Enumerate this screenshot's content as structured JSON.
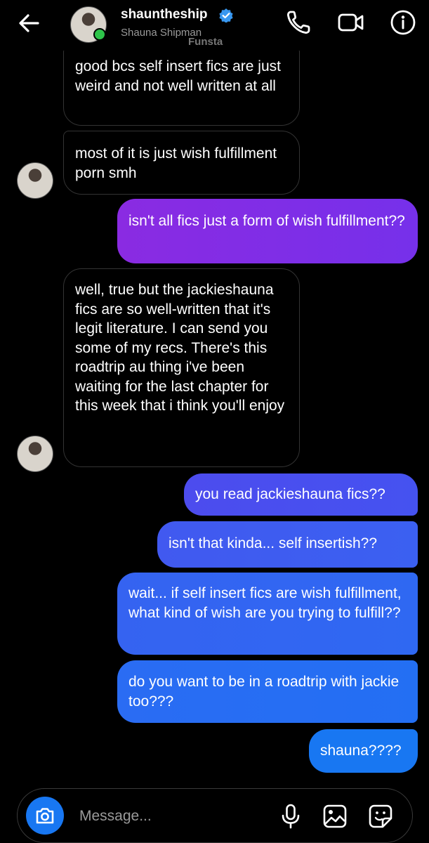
{
  "header": {
    "username": "shauntheship",
    "display_name": "Shauna Shipman",
    "watermark": "Funsta",
    "icons": [
      "back-arrow-icon",
      "verified-badge-icon",
      "phone-call-icon",
      "video-call-icon",
      "info-icon"
    ]
  },
  "messages": [
    {
      "from": "them",
      "text": "good bcs self insert fics are just weird and not well written at all"
    },
    {
      "from": "them",
      "text": "most of it is just wish fulfillment porn smh"
    },
    {
      "from": "me",
      "text": "isn't all fics just a form of wish fulfillment??"
    },
    {
      "from": "them",
      "text": "well, true but the jackieshauna fics are so well-written that it's legit literature. I can send you some of my recs. There's this roadtrip au thing i've been waiting for the last chapter for this week that i think you'll enjoy"
    },
    {
      "from": "me",
      "text": "you read jackieshauna fics??"
    },
    {
      "from": "me",
      "text": "isn't that kinda... self insertish??"
    },
    {
      "from": "me",
      "text": "wait... if self insert fics are wish fulfillment, what kind of wish are you trying to fulfill??"
    },
    {
      "from": "me",
      "text": "do you want to be in a roadtrip with jackie too???"
    },
    {
      "from": "me",
      "text": "shauna????"
    }
  ],
  "composer": {
    "placeholder": "Message...",
    "icons": [
      "camera-icon",
      "microphone-icon",
      "gallery-icon",
      "sticker-icon"
    ]
  },
  "colors": {
    "background": "#000000",
    "outgoing_gradient": [
      "#8a2be2",
      "#6a3cf0",
      "#3d5cf2",
      "#1877f2"
    ],
    "incoming_border": "#333333",
    "accent": "#1877f2"
  }
}
